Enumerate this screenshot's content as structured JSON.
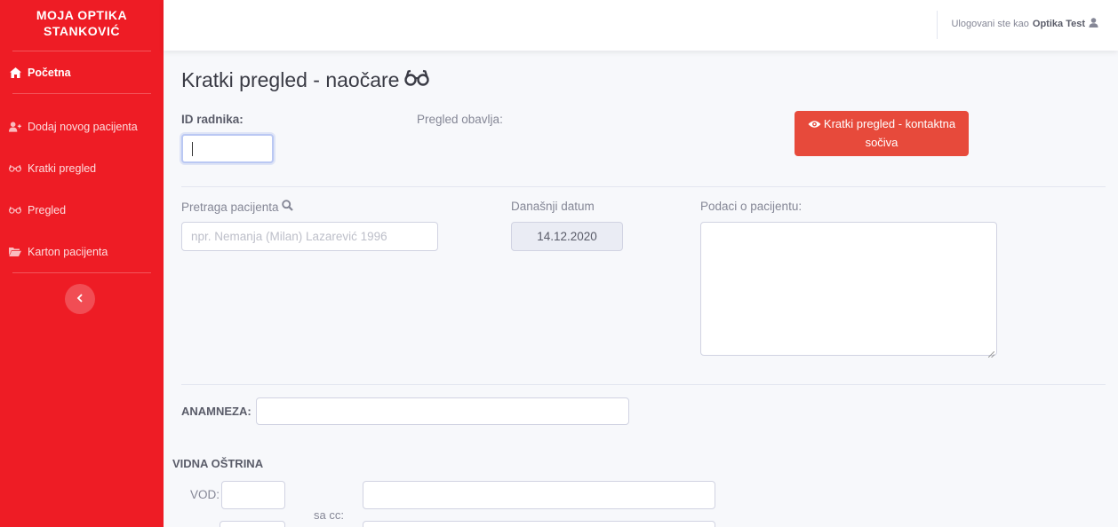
{
  "sidebar": {
    "brand_line1": "MOJA OPTIKA",
    "brand_line2": "STANKOVIĆ",
    "items": [
      {
        "label": "Početna",
        "icon": "home-icon"
      },
      {
        "label": "Dodaj novog pacijenta",
        "icon": "user-plus-icon"
      },
      {
        "label": "Kratki pregled",
        "icon": "glasses-icon"
      },
      {
        "label": "Pregled",
        "icon": "glasses-icon"
      },
      {
        "label": "Karton pacijenta",
        "icon": "folder-open-icon"
      }
    ],
    "toggle_icon": "chevron-left-icon"
  },
  "topbar": {
    "user_prefix": "Ulogovani ste kao",
    "user_name": "Optika Test"
  },
  "main": {
    "title": "Kratki pregled - naočare",
    "id_label": "ID radnika:",
    "id_value": "",
    "performer_label": "Pregled obavlja:",
    "contact_button": "Kratki pregled - kontaktna sočiva",
    "search_label": "Pretraga pacijenta",
    "search_placeholder": "npr. Nemanja (Milan) Lazarević 1996",
    "date_label": "Današnji datum",
    "date_value": "14.12.2020",
    "patient_info_label": "Podaci o pacijentu:",
    "anamneza_label": "ANAMNEZA:",
    "vision_section": "VIDNA OŠTRINA",
    "vod_label": "VOD:",
    "sacc_label": "sa cc:"
  },
  "colors": {
    "sidebar": "#ee1c25",
    "danger": "#e74a3b"
  }
}
